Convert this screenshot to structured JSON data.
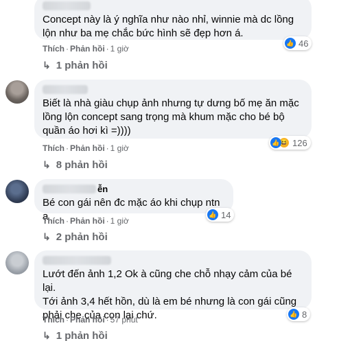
{
  "comments": [
    {
      "text_lines": [
        "Concept này là ý nghĩa như nào nhỉ, winnie mà dc lồng",
        "lộn như ba mẹ chắc bức hình sẽ đẹp hơn á."
      ],
      "like_label": "Thích",
      "reply_label": "Phản hồi",
      "time": "1 giờ",
      "reaction_count": "46",
      "replies_label": "1 phản hồi"
    },
    {
      "text_lines": [
        "Biết là nhà giàu chụp ảnh nhưng tự dưng bố mẹ ăn mặc",
        "lồng lộn concept sang trọng mà khum mặc cho bé bộ",
        "quần áo hơi kì =))))"
      ],
      "like_label": "Thích",
      "reply_label": "Phản hồi",
      "time": "1 giờ",
      "reaction_count": "126",
      "replies_label": "8 phản hồi"
    },
    {
      "name_tail": "ễn",
      "text_lines": [
        "Bé con gái nên đc mặc áo khi chụp ntn ạ"
      ],
      "like_label": "Thích",
      "reply_label": "Phản hồi",
      "time": "1 giờ",
      "reaction_count": "14",
      "replies_label": "2 phản hồi"
    },
    {
      "text_lines": [
        "Lướt đến ảnh 1,2 Ok à cũng che chỗ nhạy cảm của bé lại.",
        "Tới ảnh 3,4 hết hồn, dù là em bé nhưng là con gái cũng",
        "phải che của con lại chứ."
      ],
      "like_label": "Thích",
      "reply_label": "Phản hồi",
      "time": "57 phút",
      "reaction_count": "8",
      "replies_label": "1 phản hồi"
    }
  ],
  "icons": {
    "like": "like-icon",
    "haha": "haha-icon",
    "reply_arrow": "reply-arrow-icon"
  },
  "colors": {
    "like_blue": "#1877f2",
    "haha_yellow": "#f7b125",
    "bubble": "#f0f2f5",
    "meta": "#65676b"
  }
}
